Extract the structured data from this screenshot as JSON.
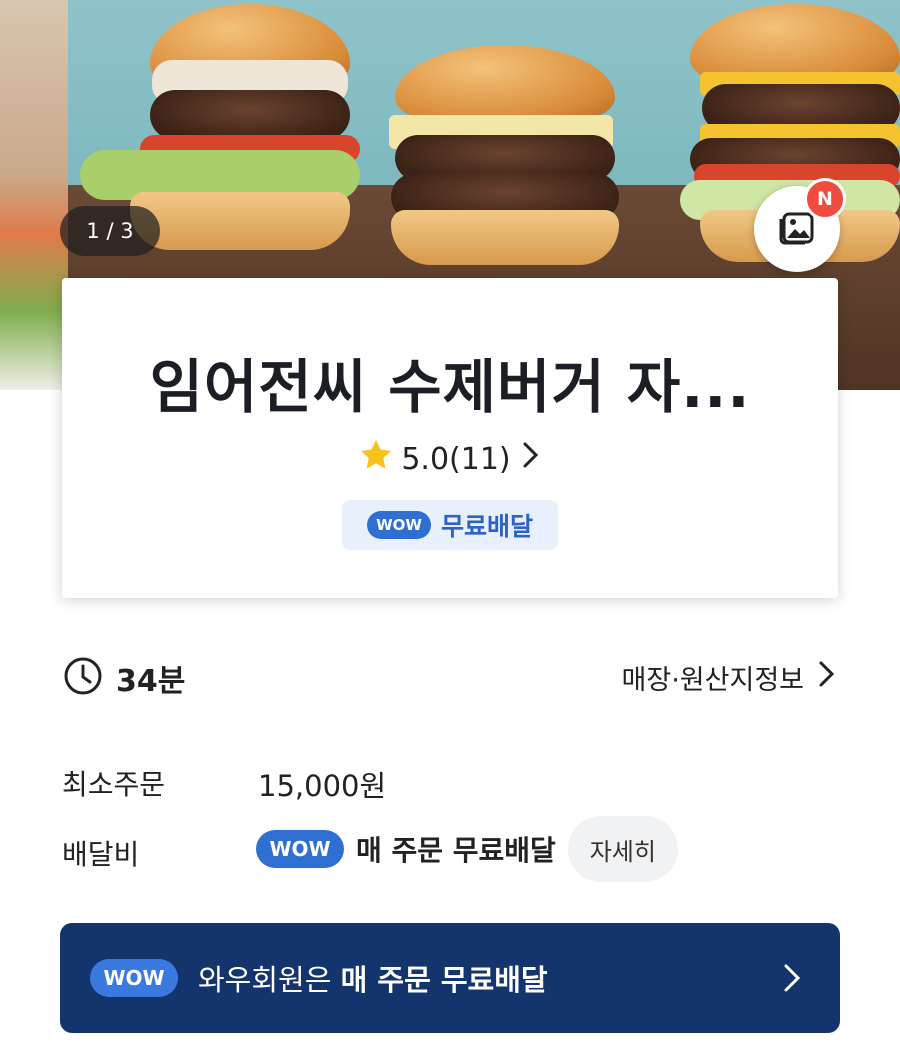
{
  "hero": {
    "slide_counter": "1 / 3",
    "photo_badge": "N"
  },
  "store": {
    "name": "임어전씨 수제버거 자...",
    "rating": "5.0(11)",
    "wow_label": "WOW",
    "free_delivery": "무료배달"
  },
  "delivery": {
    "time": "34분",
    "origin_link": "매장·원산지정보"
  },
  "info": {
    "min_order_label": "최소주문",
    "min_order_value": "15,000원",
    "fee_label": "배달비",
    "fee_wow": "WOW",
    "fee_text": "매 주문 무료배달",
    "detail_button": "자세히"
  },
  "banner": {
    "wow": "WOW",
    "text_prefix": "와우회원은 ",
    "text_bold": "매 주문 무료배달"
  },
  "colors": {
    "accent": "#2e6fd1",
    "banner_bg": "#13346c",
    "badge_red": "#ef4b3f",
    "star": "#f6c21b"
  }
}
